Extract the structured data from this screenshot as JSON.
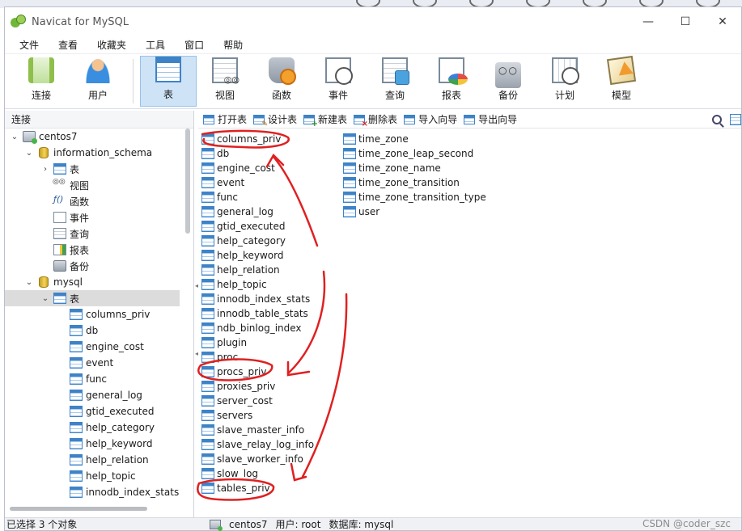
{
  "window": {
    "title": "Navicat for MySQL",
    "controls": [
      "—",
      "☐",
      "✕"
    ]
  },
  "menu": [
    "文件",
    "查看",
    "收藏夹",
    "工具",
    "窗口",
    "帮助"
  ],
  "toolbar": {
    "items": [
      {
        "label": "连接",
        "icon": "connection-icon"
      },
      {
        "label": "用户",
        "icon": "user-icon"
      },
      {
        "label": "表",
        "icon": "table-icon",
        "active": true
      },
      {
        "label": "视图",
        "icon": "view-icon"
      },
      {
        "label": "函数",
        "icon": "function-icon"
      },
      {
        "label": "事件",
        "icon": "event-icon"
      },
      {
        "label": "查询",
        "icon": "query-icon"
      },
      {
        "label": "报表",
        "icon": "report-icon"
      },
      {
        "label": "备份",
        "icon": "backup-icon"
      },
      {
        "label": "计划",
        "icon": "schedule-icon"
      },
      {
        "label": "模型",
        "icon": "model-icon"
      }
    ]
  },
  "left_pane": {
    "header": "连接",
    "tree": [
      {
        "label": "centos7",
        "type": "server",
        "twisty": "⌄"
      },
      {
        "label": "information_schema",
        "type": "db",
        "twisty": "⌄"
      },
      {
        "label": "表",
        "type": "table",
        "twisty": "›"
      },
      {
        "label": "视图",
        "type": "view",
        "twisty": ""
      },
      {
        "label": "函数",
        "type": "func",
        "twisty": ""
      },
      {
        "label": "事件",
        "type": "event",
        "twisty": ""
      },
      {
        "label": "查询",
        "type": "query",
        "twisty": ""
      },
      {
        "label": "报表",
        "type": "report",
        "twisty": ""
      },
      {
        "label": "备份",
        "type": "backup",
        "twisty": ""
      },
      {
        "label": "mysql",
        "type": "db",
        "twisty": "⌄"
      },
      {
        "label": "表",
        "type": "table",
        "twisty": "⌄",
        "selected": true
      },
      {
        "label": "columns_priv",
        "type": "table",
        "twisty": ""
      },
      {
        "label": "db",
        "type": "table",
        "twisty": ""
      },
      {
        "label": "engine_cost",
        "type": "table",
        "twisty": ""
      },
      {
        "label": "event",
        "type": "table",
        "twisty": ""
      },
      {
        "label": "func",
        "type": "table",
        "twisty": ""
      },
      {
        "label": "general_log",
        "type": "table",
        "twisty": ""
      },
      {
        "label": "gtid_executed",
        "type": "table",
        "twisty": ""
      },
      {
        "label": "help_category",
        "type": "table",
        "twisty": ""
      },
      {
        "label": "help_keyword",
        "type": "table",
        "twisty": ""
      },
      {
        "label": "help_relation",
        "type": "table",
        "twisty": ""
      },
      {
        "label": "help_topic",
        "type": "table",
        "twisty": ""
      },
      {
        "label": "innodb_index_stats",
        "type": "table",
        "twisty": ""
      }
    ]
  },
  "object_toolbar": [
    {
      "label": "打开表",
      "mod": ""
    },
    {
      "label": "设计表",
      "mod": "pen"
    },
    {
      "label": "新建表",
      "mod": "plus"
    },
    {
      "label": "删除表",
      "mod": "del"
    },
    {
      "label": "导入向导",
      "mod": ""
    },
    {
      "label": "导出向导",
      "mod": ""
    }
  ],
  "tables": {
    "col1": [
      "columns_priv",
      "db",
      "engine_cost",
      "event",
      "func",
      "general_log",
      "gtid_executed",
      "help_category",
      "help_keyword",
      "help_relation",
      "help_topic",
      "innodb_index_stats",
      "innodb_table_stats",
      "ndb_binlog_index",
      "plugin",
      "proc",
      "procs_priv",
      "proxies_priv",
      "server_cost",
      "servers",
      "slave_master_info",
      "slave_relay_log_info",
      "slave_worker_info",
      "slow_log",
      "tables_priv"
    ],
    "col2": [
      "time_zone",
      "time_zone_leap_second",
      "time_zone_name",
      "time_zone_transition",
      "time_zone_transition_type",
      "user"
    ]
  },
  "status": {
    "left": "已选择 3 个对象",
    "server": "centos7",
    "user": "用户: root",
    "database": "数据库: mysql"
  },
  "watermark": "CSDN @coder_szc",
  "colors": {
    "annotation": "#e02020",
    "selection": "#cfe3f7",
    "tree_selection": "#dcdcdc"
  }
}
